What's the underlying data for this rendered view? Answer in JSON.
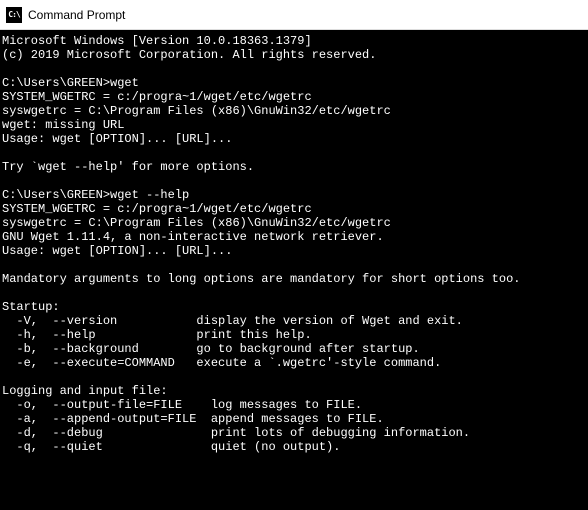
{
  "window": {
    "title": "Command Prompt",
    "icon_label": "C:\\"
  },
  "terminal": {
    "lines": [
      "Microsoft Windows [Version 10.0.18363.1379]",
      "(c) 2019 Microsoft Corporation. All rights reserved.",
      "",
      "C:\\Users\\GREEN>wget",
      "SYSTEM_WGETRC = c:/progra~1/wget/etc/wgetrc",
      "syswgetrc = C:\\Program Files (x86)\\GnuWin32/etc/wgetrc",
      "wget: missing URL",
      "Usage: wget [OPTION]... [URL]...",
      "",
      "Try `wget --help' for more options.",
      "",
      "C:\\Users\\GREEN>wget --help",
      "SYSTEM_WGETRC = c:/progra~1/wget/etc/wgetrc",
      "syswgetrc = C:\\Program Files (x86)\\GnuWin32/etc/wgetrc",
      "GNU Wget 1.11.4, a non-interactive network retriever.",
      "Usage: wget [OPTION]... [URL]...",
      "",
      "Mandatory arguments to long options are mandatory for short options too.",
      "",
      "Startup:",
      "  -V,  --version           display the version of Wget and exit.",
      "  -h,  --help              print this help.",
      "  -b,  --background        go to background after startup.",
      "  -e,  --execute=COMMAND   execute a `.wgetrc'-style command.",
      "",
      "Logging and input file:",
      "  -o,  --output-file=FILE    log messages to FILE.",
      "  -a,  --append-output=FILE  append messages to FILE.",
      "  -d,  --debug               print lots of debugging information.",
      "  -q,  --quiet               quiet (no output)."
    ]
  }
}
